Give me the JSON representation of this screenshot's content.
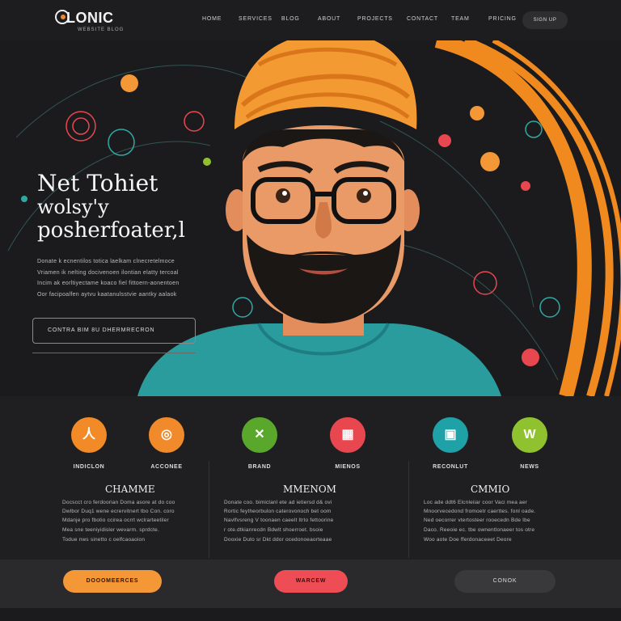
{
  "brand": {
    "name": "LONIC",
    "tagline": "WEBSITE BLOG"
  },
  "nav": {
    "items": [
      "HOME",
      "SERVICES",
      "BLOG",
      "ABOUT",
      "PROJECTS",
      "CONTACT",
      "TEAM",
      "PRICING"
    ],
    "cta": "SIGN UP"
  },
  "hero": {
    "title_lines": [
      "Net Tohiet",
      "wolsy'y",
      "posherfoater,l"
    ],
    "body_lines": [
      "Donate k ecnentilos totica laelkam clnecretelmoce",
      "Vriamen ik nelting docivenoen ilontian elatty tercoal",
      "Incim ak eorltiyectame koaco fiel fittoern-aonentoen",
      "Oor facipoalfen aytvu kaatanulsstvie aantky aalaok"
    ],
    "cta_label": "CONTRA BIM 8U DHERMRECRON"
  },
  "features": [
    {
      "label": "INDICLON",
      "icon": "person-icon",
      "glyph": "人",
      "color": "#f18a27"
    },
    {
      "label": "ACCONEE",
      "icon": "disc-icon",
      "glyph": "◎",
      "color": "#f08a2a"
    },
    {
      "label": "BRAND",
      "icon": "tools-icon",
      "glyph": "✕",
      "color": "#5aa82b"
    },
    {
      "label": "MIENOS",
      "icon": "calendar-icon",
      "glyph": "▦",
      "color": "#e94750"
    },
    {
      "label": "RECONLUT",
      "icon": "chat-icon",
      "glyph": "▣",
      "color": "#1fa1a8"
    },
    {
      "label": "NEWS",
      "icon": "badge-icon",
      "glyph": "W",
      "color": "#8fc22e"
    }
  ],
  "columns": [
    {
      "title": "CHAMME",
      "lines": [
        "Docscct cro ferdoorian Doma asore at do coo",
        "Dwlbor Duq1 wene ecrervitnert tbo Con. coro",
        "Mdanje pro fbotio ccirea ocrrt wclrarteetiler",
        "Mea sne teeniyidisler wevarm. sprdcte.",
        "Todue nws sinetto c oelfcaoaoion"
      ]
    },
    {
      "title": "MMENOM",
      "lines": [
        "Donate coo. bimiclanl ete ad ietiersd d& ovi",
        "Rortic feytheorbulon caterovonoch bet oom",
        "Navlfvsreng V toonaen caeelt ltrto fettoorine",
        "r ote.dtkianrecdn Bdwlt shoerroet. bsoie",
        "Dooxie Duto sr Dkt ddor ocedonoeaorteaae"
      ]
    },
    {
      "title": "CMMIO",
      "lines": [
        "Loc ade ddt6 Elcnleiiar coor Vaci mea aer",
        "Mnoorvecedond fromoetr caerttes. fonl oade.",
        "Ned oecorrer vtertosteer rooecedn Bde Ibe",
        "Daco. Reeoie ec. tbe ownentlonaeer tos otre",
        "Woo aote Doe fferdonaceeet Deore"
      ]
    }
  ],
  "bottom_buttons": {
    "primary": "DOOOMEERCES",
    "secondary": "WARCEW",
    "tertiary": "CONOK"
  }
}
